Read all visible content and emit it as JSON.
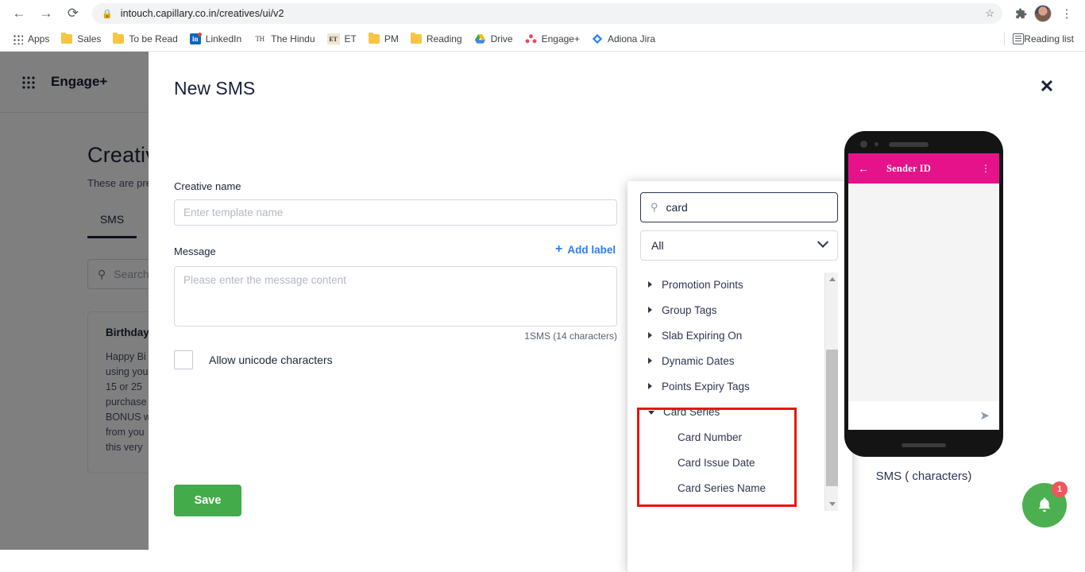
{
  "browser": {
    "back_icon": "←",
    "forward_icon": "→",
    "reload_icon": "⟳",
    "lock_icon": "🔒",
    "url": "intouch.capillary.co.in/creatives/ui/v2",
    "star_icon": "☆",
    "extensions_icon": "puzzle-piece",
    "menu_icon": "⋮",
    "bookmarks": [
      {
        "label": "Apps",
        "icon": "apps-grid-icon"
      },
      {
        "label": "Sales",
        "icon": "folder-icon"
      },
      {
        "label": "To be Read",
        "icon": "folder-icon"
      },
      {
        "label": "LinkedIn",
        "icon": "linkedin-icon"
      },
      {
        "label": "The Hindu",
        "icon": "the-hindu-icon"
      },
      {
        "label": "ET",
        "icon": "economic-times-icon"
      },
      {
        "label": "PM",
        "icon": "folder-icon"
      },
      {
        "label": "Reading",
        "icon": "folder-icon"
      },
      {
        "label": "Drive",
        "icon": "google-drive-icon"
      },
      {
        "label": "Engage+",
        "icon": "engage-plus-icon"
      },
      {
        "label": "Adiona Jira",
        "icon": "jira-icon"
      }
    ],
    "reading_list": {
      "label": "Reading list",
      "icon": "reading-list-icon"
    }
  },
  "app": {
    "brand": "Engage+",
    "grid_icon": "apps-grid-icon",
    "page_title": "Creativ",
    "page_subtitle": "These are pre",
    "tabs": [
      {
        "label": "SMS",
        "active": true
      }
    ],
    "search_placeholder": "Search",
    "search_icon": "search-icon",
    "card": {
      "title": "Birthday",
      "body": "Happy Bi\nusing you\n15 or 25\npurchase\nBONUS w\nfrom you\nthis very"
    }
  },
  "modal": {
    "title": "New SMS",
    "close_icon": "✕",
    "creative_name": {
      "label": "Creative name",
      "placeholder": "Enter template name",
      "value": ""
    },
    "message": {
      "label": "Message",
      "placeholder": "Please enter the message content",
      "value": "",
      "add_label_text": "Add label",
      "add_label_icon": "plus-icon",
      "counter": "1SMS (14 characters)"
    },
    "unicode": {
      "label": "Allow unicode characters",
      "checked": false
    },
    "save_label": "Save"
  },
  "token_picker": {
    "search": {
      "value": "card",
      "placeholder": "",
      "icon": "search-icon"
    },
    "filter": {
      "selected": "All",
      "caret_icon": "chevron-down-icon"
    },
    "nodes": [
      {
        "label": "Promotion Points",
        "expanded": false,
        "children": []
      },
      {
        "label": "Group Tags",
        "expanded": false,
        "children": []
      },
      {
        "label": "Slab Expiring On",
        "expanded": false,
        "children": []
      },
      {
        "label": "Dynamic Dates",
        "expanded": false,
        "children": []
      },
      {
        "label": "Points Expiry Tags",
        "expanded": false,
        "children": []
      },
      {
        "label": "Card Series",
        "expanded": true,
        "children": [
          "Card Number",
          "Card Issue Date",
          "Card Series Name"
        ]
      }
    ],
    "scrollbar": {
      "up_icon": "▲",
      "down_icon": "▼"
    },
    "highlight_color": "#ef1111"
  },
  "phone_preview": {
    "back_icon": "←",
    "sender_id": "Sender ID",
    "kebab_icon": "⋮",
    "send_icon": "➤",
    "caption": "SMS ( characters)",
    "appbar_color": "#e5128a"
  },
  "notification": {
    "bell_icon": "bell-icon",
    "count": "1",
    "color": "#4cb050",
    "badge_color": "#f2545b"
  }
}
